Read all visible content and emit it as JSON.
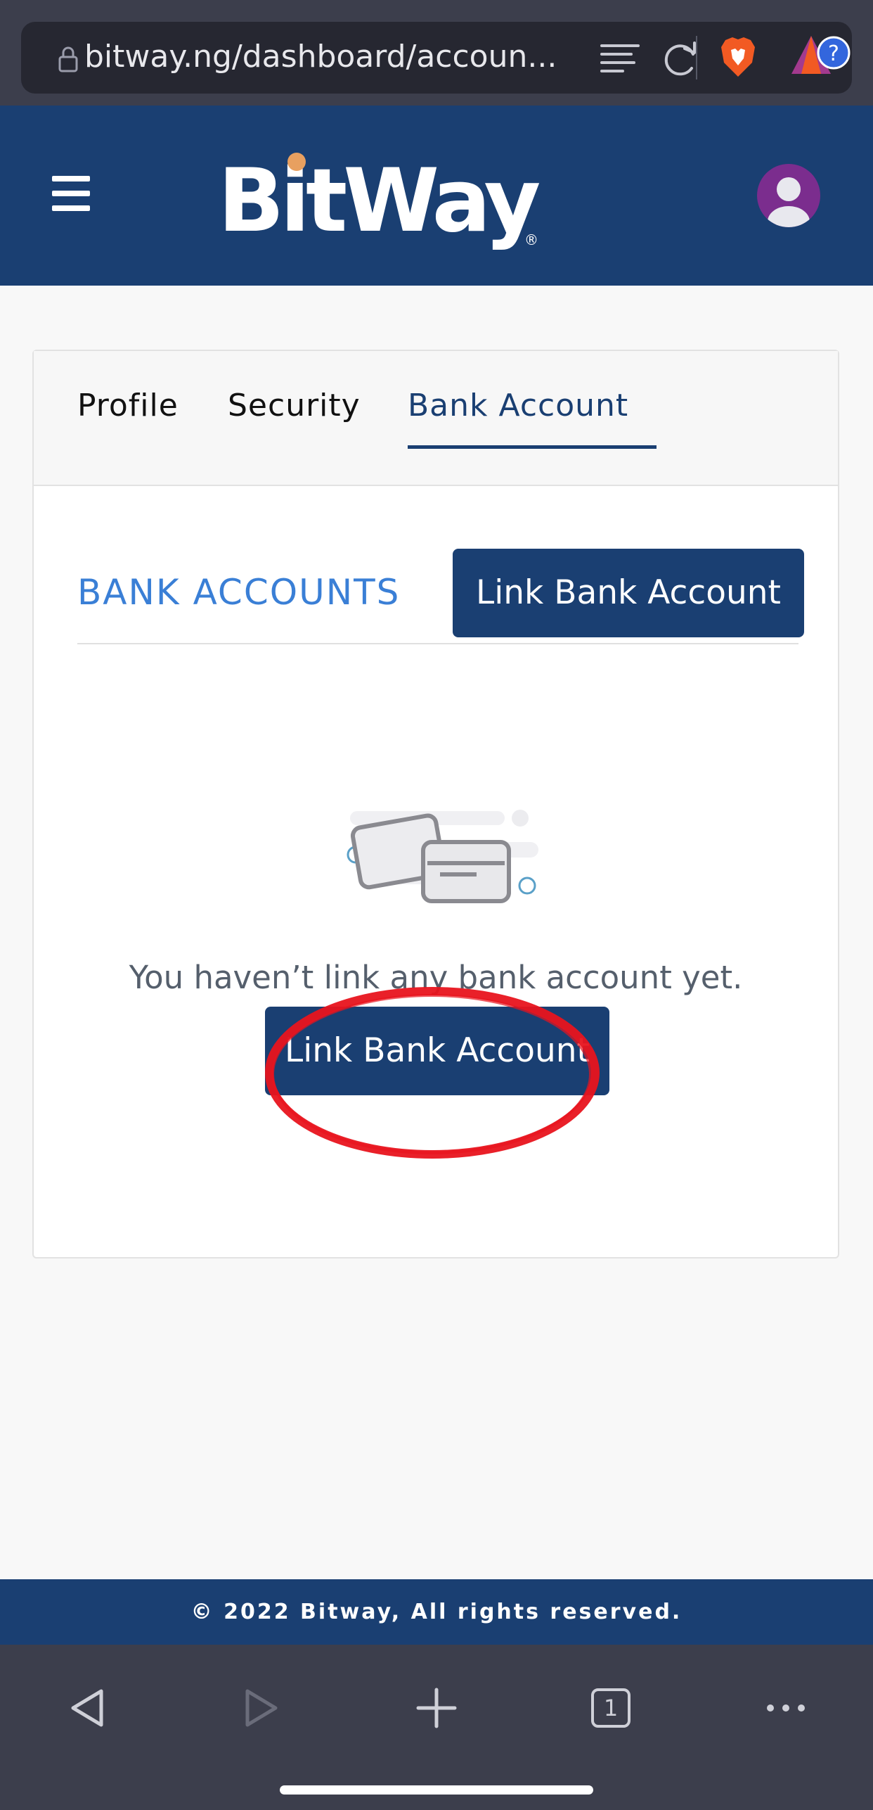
{
  "browser": {
    "url": "bitway.ng/dashboard/accoun...",
    "tab_count": "1"
  },
  "header": {
    "logo_text": "BitWay"
  },
  "tabs": [
    {
      "label": "Profile"
    },
    {
      "label": "Security"
    },
    {
      "label": "Bank Account",
      "active": true
    }
  ],
  "bank_section": {
    "title": "BANK ACCOUNTS",
    "link_button_label": "Link Bank Account",
    "empty_message": "You haven’t link any bank account yet.",
    "empty_button_label": "Link Bank Account"
  },
  "footer": {
    "text": "© 2022 Bitway, All rights reserved."
  },
  "colors": {
    "brand_navy": "#1a3f72",
    "section_title_blue": "#3a7fd6",
    "browser_chrome": "#3c3e4c",
    "annotation_red": "#e8141e",
    "avatar_purple": "#7b2d8e",
    "logo_dot_orange": "#e8a060"
  },
  "icons": [
    "lock-icon",
    "reader-mode-icon",
    "reload-icon",
    "brave-shields-icon",
    "brave-rewards-icon",
    "hamburger-icon",
    "user-avatar-icon",
    "credit-card-icon",
    "back-arrow-icon",
    "forward-arrow-icon",
    "plus-icon",
    "tabs-icon",
    "more-icon"
  ]
}
